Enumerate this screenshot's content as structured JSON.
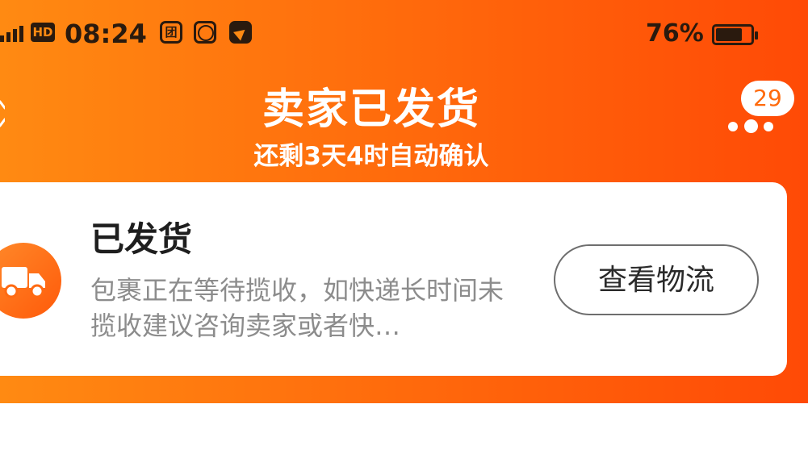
{
  "status_bar": {
    "network_label": "HD",
    "time": "08:24",
    "tuan_icon_glyph": "团",
    "battery_percent": "76%",
    "battery_level": 0.76,
    "icons": [
      "signal-icon",
      "hd-icon",
      "tuan-app-icon",
      "du-app-icon",
      "send-app-icon",
      "battery-icon"
    ]
  },
  "header": {
    "title": "卖家已发货",
    "subtitle": "还剩3天4时自动确认",
    "message_badge_count": "29",
    "more_icon": "more-dots-icon",
    "gradient_start": "#ff8a12",
    "gradient_end": "#ff4a06"
  },
  "shipping_card": {
    "status_icon": "delivery-truck-icon",
    "status_title": "已发货",
    "status_description": "包裹正在等待揽收，如快递长时间未揽收建议咨询卖家或者快…",
    "action_button_label": "查看物流"
  }
}
